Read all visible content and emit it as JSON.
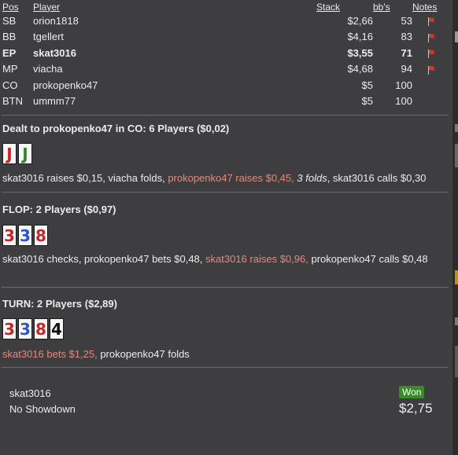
{
  "players": {
    "headers": {
      "pos": "Pos",
      "player": "Player",
      "stack": "Stack",
      "bbs": "bb's",
      "notes": "Notes"
    },
    "rows": [
      {
        "pos": "SB",
        "name": "orion1818",
        "stack": "$2,66",
        "bbs": "53",
        "flag": true,
        "hero": false
      },
      {
        "pos": "BB",
        "name": "tgellert",
        "stack": "$4,16",
        "bbs": "83",
        "flag": true,
        "hero": false
      },
      {
        "pos": "EP",
        "name": "skat3016",
        "stack": "$3,55",
        "bbs": "71",
        "flag": true,
        "hero": true
      },
      {
        "pos": "MP",
        "name": "viacha",
        "stack": "$4,68",
        "bbs": "94",
        "flag": true,
        "hero": false
      },
      {
        "pos": "CO",
        "name": "prokopenko47",
        "stack": "$5",
        "bbs": "100",
        "flag": false,
        "hero": false
      },
      {
        "pos": "BTN",
        "name": "ummm77",
        "stack": "$5",
        "bbs": "100",
        "flag": false,
        "hero": false
      }
    ]
  },
  "preflop": {
    "title": "Dealt to prokopenko47 in CO: 6 Players ($0,02)",
    "cards": [
      {
        "rank": "J",
        "suit": "hearts"
      },
      {
        "rank": "J",
        "suit": "clubs"
      }
    ],
    "action": {
      "a1": "skat3016 raises $0,15, viacha folds,",
      "a2": "prokopenko47 raises $0,45,",
      "a3": "3 folds",
      "a4": ", skat3016 calls $0,30"
    }
  },
  "flop": {
    "title": "FLOP: 2 Players ($0,97)",
    "cards": [
      {
        "rank": "3",
        "suit": "hearts"
      },
      {
        "rank": "3",
        "suit": "diamonds"
      },
      {
        "rank": "8",
        "suit": "hearts"
      }
    ],
    "action": {
      "a1": "skat3016 checks, prokopenko47 bets $0,48,",
      "a2": "skat3016 raises $0,96,",
      "a3": "prokopenko47 calls $0,48"
    }
  },
  "turn": {
    "title": "TURN: 2 Players ($2,89)",
    "cards": [
      {
        "rank": "3",
        "suit": "hearts"
      },
      {
        "rank": "3",
        "suit": "diamonds"
      },
      {
        "rank": "8",
        "suit": "hearts"
      },
      {
        "rank": "4",
        "suit": "spades"
      }
    ],
    "action": {
      "a1": "skat3016 bets $1,25,",
      "a2": "prokopenko47 folds"
    }
  },
  "result": {
    "winner": "skat3016",
    "detail": "No Showdown",
    "badge": "Won",
    "amount": "$2,75"
  },
  "colors": {
    "background": "#3e3e40",
    "highlight": "#e4897d",
    "won_badge": "#3a8a2a"
  }
}
